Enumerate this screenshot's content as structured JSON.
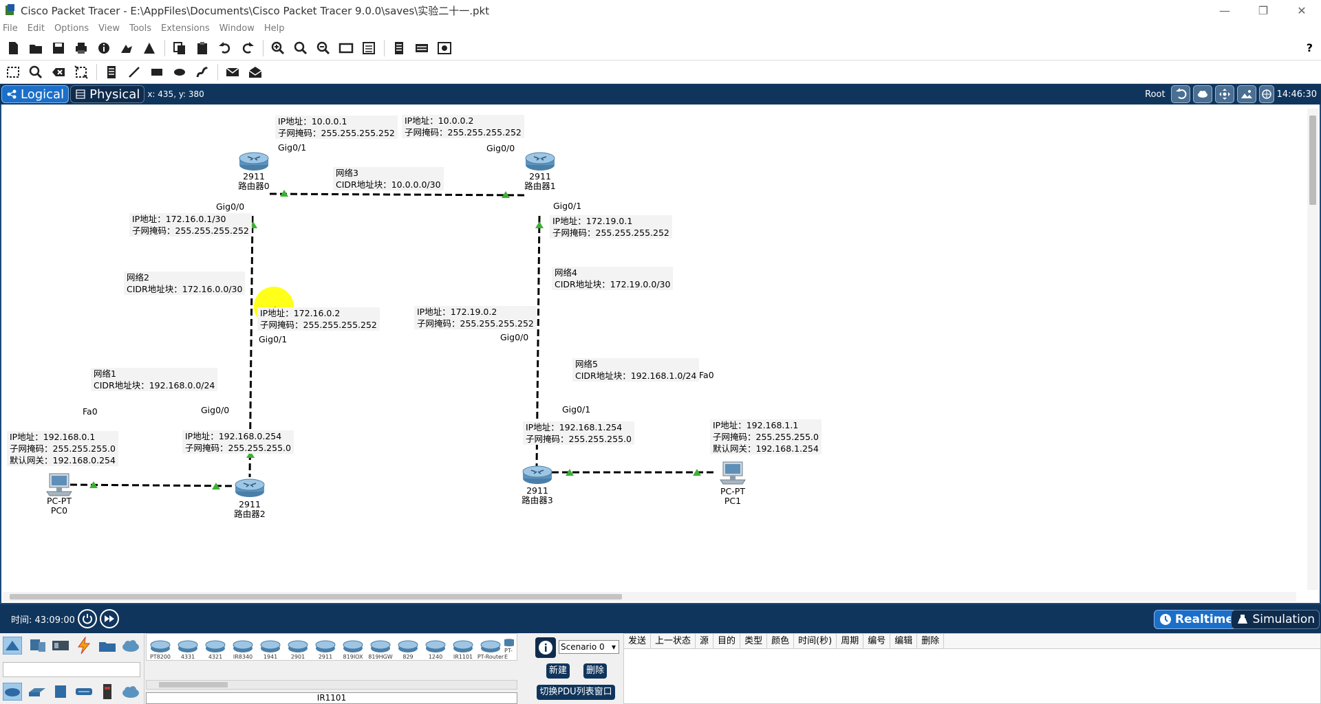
{
  "window": {
    "title": "Cisco Packet Tracer - E:\\AppFiles\\Documents\\Cisco Packet Tracer 9.0.0\\saves\\实验二十一.pkt",
    "minimize": "—",
    "restore": "❐",
    "close": "✕"
  },
  "menu": [
    "File",
    "Edit",
    "Options",
    "View",
    "Tools",
    "Extensions",
    "Window",
    "Help"
  ],
  "toolbar": {
    "help": "?"
  },
  "view": {
    "logical": "Logical",
    "physical": "Physical",
    "coords": "x: 435, y: 380",
    "root": "Root",
    "clock": "14:46:30"
  },
  "notes": {
    "r0_gig01": "IP地址：10.0.0.1\n子网掩码：255.255.255.252",
    "r1_gig00": "IP地址：10.0.0.2\n子网掩码：255.255.255.252",
    "net3": "网络3\nCIDR地址块：10.0.0.0/30",
    "r0_gig00": "IP地址：172.16.0.1/30\n子网掩码：255.255.255.252",
    "r1_gig01": "IP地址：172.19.0.1\n子网掩码：255.255.255.252",
    "net2": "网络2\nCIDR地址块：172.16.0.0/30",
    "net4": "网络4\nCIDR地址块：172.19.0.0/30",
    "r2_gig01": "IP地址：172.16.0.2\n子网掩码：255.255.255.252",
    "r3_gig00": "IP地址：172.19.0.2\n子网掩码：255.255.255.252",
    "net1": "网络1\nCIDR地址块：192.168.0.0/24",
    "net5": "网络5\nCIDR地址块：192.168.1.0/24",
    "pc0": "IP地址：192.168.0.1\n子网掩码：255.255.255.0\n默认网关：192.168.0.254",
    "r2_gig00": "IP地址：192.168.0.254\n子网掩码：255.255.255.0",
    "r3_gig01": "IP地址：192.168.1.254\n子网掩码：255.255.255.0",
    "pc1": "IP地址：192.168.1.1\n子网掩码：255.255.255.0\n默认网关：192.168.1.254"
  },
  "ports": {
    "r0_top": "Gig0/1",
    "r1_top": "Gig0/0",
    "r0_down": "Gig0/0",
    "r1_down": "Gig0/1",
    "r2_up": "Gig0/1",
    "r3_up": "Gig0/0",
    "pc0_fa": "Fa0",
    "r2_left": "Gig0/0",
    "r3_right": "Gig0/1",
    "pc1_fa": "Fa0"
  },
  "devices": {
    "r0": {
      "model": "2911",
      "name": "路由器0"
    },
    "r1": {
      "model": "2911",
      "name": "路由器1"
    },
    "r2": {
      "model": "2911",
      "name": "路由器2"
    },
    "r3": {
      "model": "2911",
      "name": "路由器3"
    },
    "pc0": {
      "model": "PC-PT",
      "name": "PC0"
    },
    "pc1": {
      "model": "PC-PT",
      "name": "PC1"
    }
  },
  "timebar": {
    "time": "时间: 43:09:00",
    "realtime": "Realtime",
    "simulation": "Simulation"
  },
  "device_list": [
    "PT8200",
    "4331",
    "4321",
    "IR8340",
    "1941",
    "2901",
    "2911",
    "819IOX",
    "819HGW",
    "829",
    "1240",
    "IR1101",
    "PT-Router",
    "PT-E"
  ],
  "selected_device": "IR1101",
  "scenario": {
    "selected": "Scenario 0",
    "new": "新建",
    "delete": "删除",
    "toggle": "切换PDU列表窗口"
  },
  "pdu_columns": [
    "发送",
    "上一状态",
    "源",
    "目的",
    "类型",
    "颜色",
    "时间(秒)",
    "周期",
    "编号",
    "编辑",
    "删除"
  ],
  "colors": {
    "dark_bar": "#10355c",
    "active_tab": "#1b6fc8",
    "link_green": "#3cb034",
    "cursor_highlight": "#ffff00"
  }
}
